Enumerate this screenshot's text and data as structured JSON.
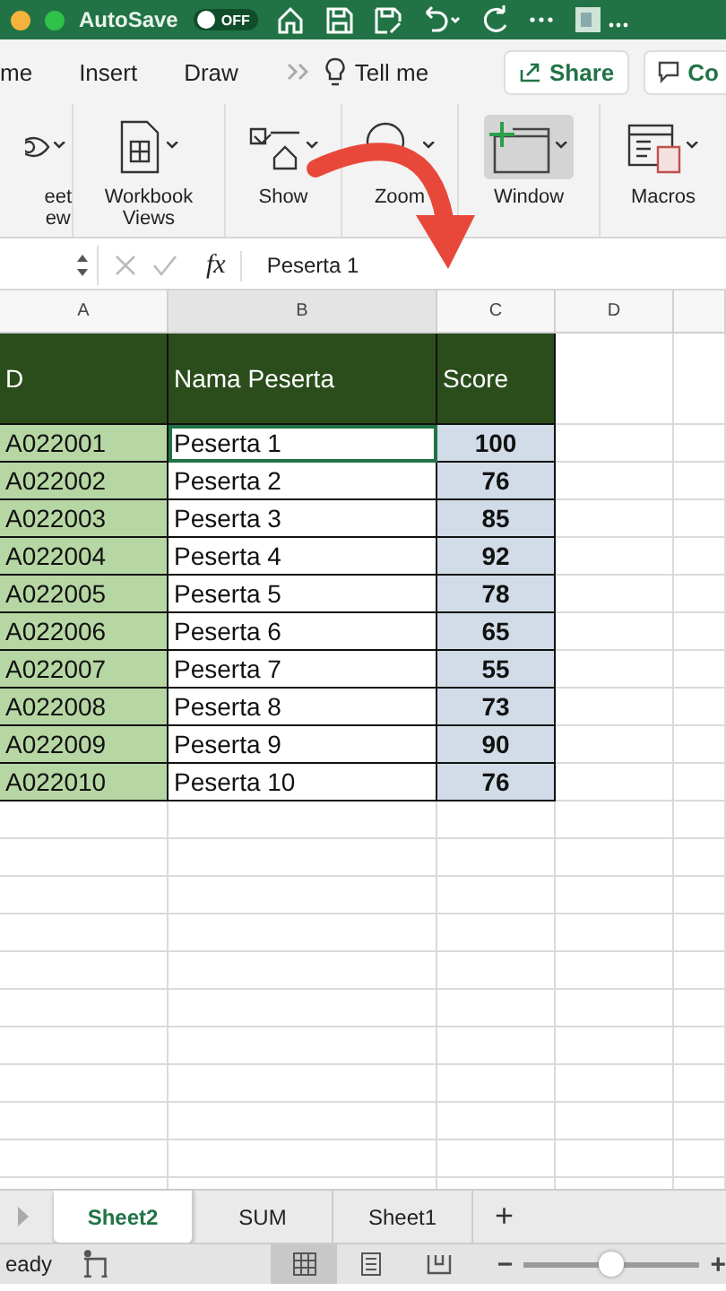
{
  "title_bar": {
    "autosave_label": "AutoSave",
    "autosave": {
      "on": false,
      "label": "OFF"
    }
  },
  "menu": {
    "tabs": [
      {
        "label": "me",
        "selected": false
      },
      {
        "label": "Insert",
        "selected": false
      },
      {
        "label": "Draw",
        "selected": false
      }
    ],
    "tell_me": "Tell me",
    "share": "Share",
    "comments": "Co"
  },
  "ribbon": [
    {
      "kind": "eye",
      "lines": [
        "eet",
        "ew"
      ],
      "selected": false
    },
    {
      "kind": "workbook",
      "lines": [
        "Workbook",
        "Views"
      ],
      "selected": false
    },
    {
      "kind": "show",
      "lines": [
        "Show"
      ],
      "selected": false
    },
    {
      "kind": "zoom",
      "lines": [
        "Zoom"
      ],
      "selected": false
    },
    {
      "kind": "window",
      "lines": [
        "Window"
      ],
      "selected": true
    },
    {
      "kind": "macros",
      "lines": [
        "Macros"
      ],
      "selected": false
    }
  ],
  "formula_bar": {
    "fx": "fx",
    "value": "Peserta 1"
  },
  "columns": [
    {
      "label": "A",
      "selected": false
    },
    {
      "label": "B",
      "selected": true
    },
    {
      "label": "C",
      "selected": false
    },
    {
      "label": "D",
      "selected": false
    }
  ],
  "table": {
    "headers": [
      "D",
      "Nama Peserta",
      "Score"
    ],
    "rows": [
      {
        "id": "A022001",
        "name": "Peserta 1",
        "score": "100",
        "selected": true
      },
      {
        "id": "A022002",
        "name": "Peserta 2",
        "score": "76",
        "selected": false
      },
      {
        "id": "A022003",
        "name": "Peserta 3",
        "score": "85",
        "selected": false
      },
      {
        "id": "A022004",
        "name": "Peserta 4",
        "score": "92",
        "selected": false
      },
      {
        "id": "A022005",
        "name": "Peserta 5",
        "score": "78",
        "selected": false
      },
      {
        "id": "A022006",
        "name": "Peserta 6",
        "score": "65",
        "selected": false
      },
      {
        "id": "A022007",
        "name": "Peserta 7",
        "score": "55",
        "selected": false
      },
      {
        "id": "A022008",
        "name": "Peserta 8",
        "score": "73",
        "selected": false
      },
      {
        "id": "A022009",
        "name": "Peserta 9",
        "score": "90",
        "selected": false
      },
      {
        "id": "A022010",
        "name": "Peserta 10",
        "score": "76",
        "selected": false
      }
    ]
  },
  "sheet_tabs": {
    "tabs": [
      {
        "label": "Sheet2",
        "selected": true
      },
      {
        "label": "SUM",
        "selected": false
      },
      {
        "label": "Sheet1",
        "selected": false
      }
    ],
    "add": "+"
  },
  "status_bar": {
    "text": "eady",
    "views": [
      {
        "kind": "normal",
        "selected": true
      },
      {
        "kind": "page",
        "selected": false
      },
      {
        "kind": "break",
        "selected": false
      }
    ],
    "minus": "−",
    "plus": "+",
    "zoom": {
      "level": 0.5
    }
  }
}
